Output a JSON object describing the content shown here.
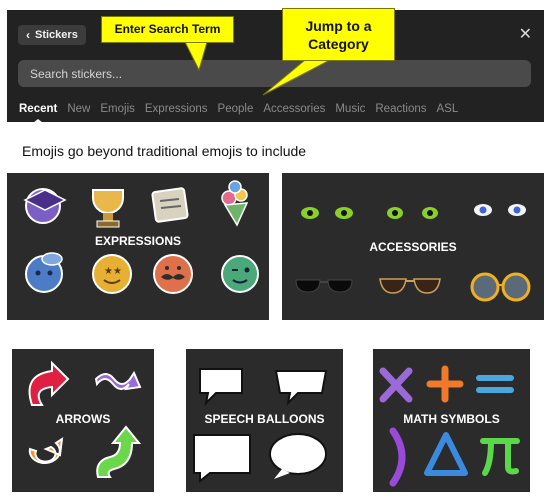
{
  "picker": {
    "back_label": "Stickers",
    "back_icon": "chevron-left-icon",
    "close_icon": "close-icon",
    "close_glyph": "✕",
    "search_placeholder": "Search stickers...",
    "tabs": [
      {
        "label": "Recent",
        "active": true
      },
      {
        "label": "New",
        "active": false
      },
      {
        "label": "Emojis",
        "active": false
      },
      {
        "label": "Expressions",
        "active": false
      },
      {
        "label": "People",
        "active": false
      },
      {
        "label": "Accessories",
        "active": false
      },
      {
        "label": "Music",
        "active": false
      },
      {
        "label": "Reactions",
        "active": false
      },
      {
        "label": "ASL",
        "active": false
      }
    ]
  },
  "callouts": {
    "search": "Enter Search Term",
    "jump_line1": "Jump to a",
    "jump_line2": "Category",
    "color": "#ffff00"
  },
  "intro": "Emojis go beyond traditional emojis to include",
  "categories": {
    "expressions": {
      "label": "EXPRESSIONS",
      "stickers": [
        "graduation-cap-sticker",
        "trophy-sticker",
        "diploma-sticker",
        "bouquet-sticker",
        "rain-cloud-face-sticker",
        "star-eyes-face-sticker",
        "mustache-face-sticker",
        "winking-face-sticker"
      ]
    },
    "accessories": {
      "label": "ACCESSORIES",
      "stickers": [
        "green-eyes-sticker",
        "green-eyes-sticker",
        "blue-eyes-sticker",
        "black-sunglasses-sticker",
        "aviator-sunglasses-sticker",
        "round-glasses-sticker"
      ]
    },
    "arrows": {
      "label": "ARROWS",
      "stickers": [
        "red-curved-arrow-sticker",
        "purple-wavy-arrow-sticker",
        "orange-circular-arrow-sticker",
        "green-up-arrow-sticker"
      ]
    },
    "speech": {
      "label": "SPEECH BALLOONS",
      "stickers": [
        "speech-balloon-sticker",
        "speech-balloon-sticker",
        "rectangular-balloon-sticker",
        "oval-balloon-sticker"
      ]
    },
    "math": {
      "label": "MATH SYMBOLS",
      "stickers": [
        "times-symbol-sticker",
        "plus-symbol-sticker",
        "equals-symbol-sticker",
        "parenthesis-sticker",
        "delta-symbol-sticker",
        "pi-symbol-sticker"
      ]
    }
  }
}
